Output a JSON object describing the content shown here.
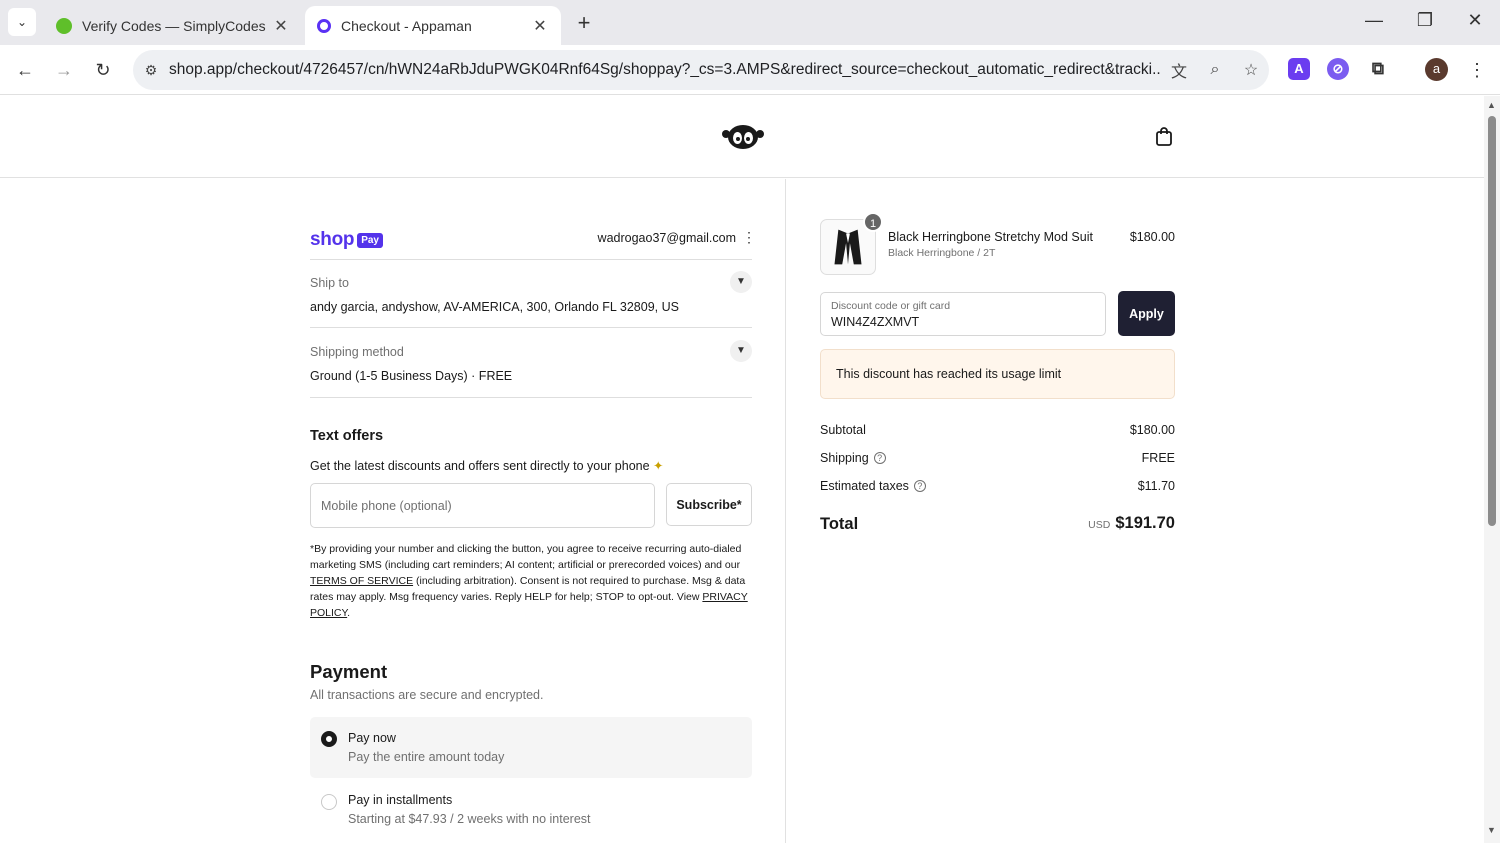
{
  "browser": {
    "tabs": [
      {
        "title": "Verify Codes — SimplyCodes",
        "active": false,
        "favicon_color": "#5fbf2a"
      },
      {
        "title": "Checkout - Appaman",
        "active": true,
        "favicon_color": "#5a31f4"
      }
    ],
    "url": "shop.app/checkout/4726457/cn/hWN24aRbJduPWGK04Rnf64Sg/shoppay?_cs=3.AMPS&redirect_source=checkout_automatic_redirect&tracki...",
    "avatar_letter": "a"
  },
  "header": {
    "logo_icon": "monkey-logo-icon",
    "cart_icon": "shopping-bag-icon"
  },
  "account": {
    "brand_word": "shop",
    "brand_badge": "Pay",
    "email": "wadrogao37@gmail.com"
  },
  "ship_to": {
    "label": "Ship to",
    "value": "andy garcia, andyshow, AV-AMERICA, 300, Orlando FL 32809, US"
  },
  "shipping_method": {
    "label": "Shipping method",
    "value": "Ground (1-5 Business Days) · FREE"
  },
  "text_offers": {
    "heading": "Text offers",
    "description": "Get the latest discounts and offers sent directly to your phone",
    "phone_placeholder": "Mobile phone (optional)",
    "subscribe_label": "Subscribe*",
    "legal_1": "*By providing your number and clicking the button, you agree to receive recurring auto-dialed marketing SMS (including cart reminders; AI content; artificial or prerecorded voices) and our ",
    "legal_terms": "TERMS OF SERVICE",
    "legal_2": " (including arbitration). Consent is not required to purchase. Msg & data rates may apply. Msg frequency varies. Reply HELP for help; STOP to opt-out. View ",
    "legal_privacy": "PRIVACY POLICY",
    "legal_3": "."
  },
  "payment": {
    "heading": "Payment",
    "subheading": "All transactions are secure and encrypted.",
    "options": [
      {
        "title": "Pay now",
        "subtitle": "Pay the entire amount today",
        "selected": true
      },
      {
        "title": "Pay in installments",
        "subtitle": "Starting at $47.93 / 2 weeks with no interest",
        "selected": false
      }
    ]
  },
  "summary": {
    "product": {
      "name": "Black Herringbone Stretchy Mod Suit",
      "variant": "Black Herringbone / 2T",
      "price": "$180.00",
      "quantity": "1"
    },
    "discount": {
      "label": "Discount code or gift card",
      "value": "WIN4Z4ZXMVT",
      "apply_label": "Apply",
      "error": "This discount has reached its usage limit"
    },
    "lines": [
      {
        "label": "Subtotal",
        "value": "$180.00",
        "info": false
      },
      {
        "label": "Shipping",
        "value": "FREE",
        "info": true
      },
      {
        "label": "Estimated taxes",
        "value": "$11.70",
        "info": true
      }
    ],
    "total_label": "Total",
    "total_currency": "USD",
    "total_value": "$191.70"
  },
  "colors": {
    "shop_purple": "#5433eb",
    "apply_button": "#1f2033",
    "alert_background": "#fff6ec"
  }
}
